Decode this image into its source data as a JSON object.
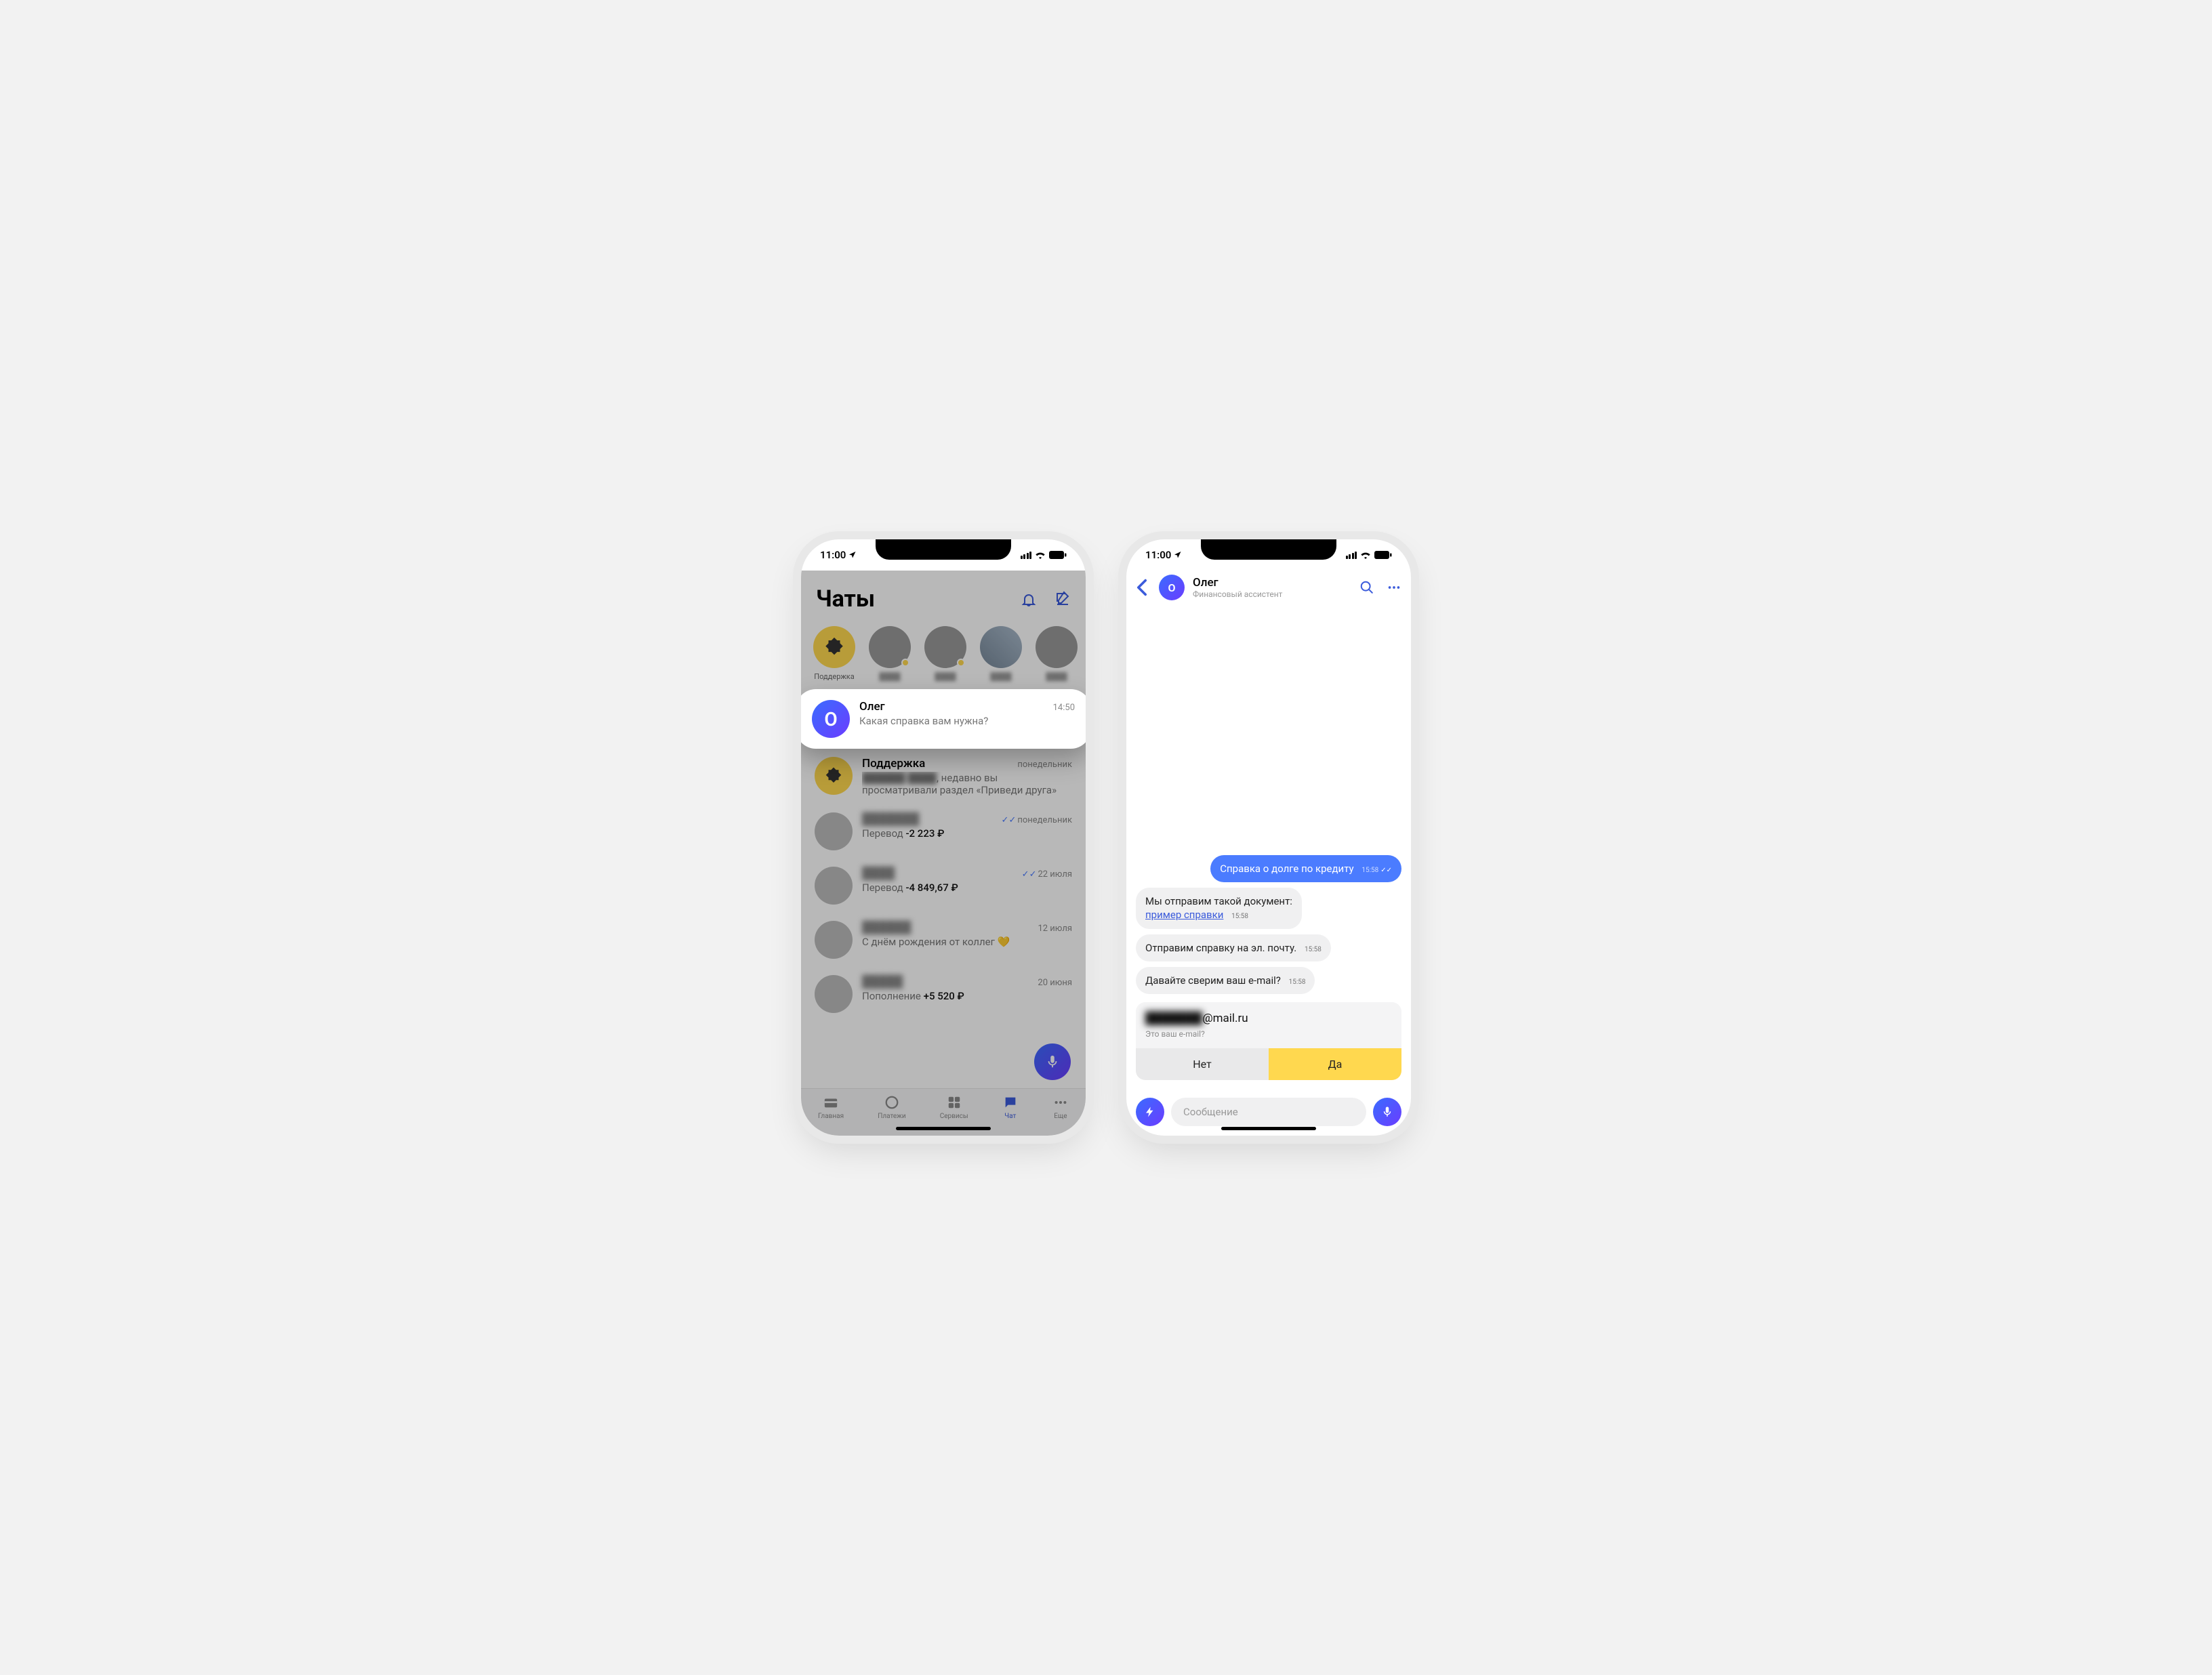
{
  "status": {
    "time": "11:00"
  },
  "left": {
    "title": "Чаты",
    "story_support": "Поддержка",
    "highlight": {
      "name": "Олег",
      "avatarLetter": "О",
      "preview": "Какая справка вам нужна?",
      "time": "14:50"
    },
    "chats": {
      "support": {
        "name": "Поддержка",
        "preview": ", недавно вы просматривали раздел «Приведи друга»",
        "time": "понедельник"
      },
      "c1": {
        "prefix": "Перевод",
        "amount": "-2 223 ₽",
        "time": "понедельник"
      },
      "c2": {
        "prefix": "Перевод",
        "amount": "-4 849,67 ₽",
        "time": "22 июля"
      },
      "c3": {
        "preview": "С днём рождения от коллег 💛",
        "time": "12 июля"
      },
      "c4": {
        "prefix": "Пополнение",
        "amount": "+5 520 ₽",
        "time": "20 июня"
      }
    },
    "tabs": {
      "home": "Главная",
      "payments": "Платежи",
      "services": "Сервисы",
      "chat": "Чат",
      "more": "Еще"
    }
  },
  "right": {
    "header": {
      "name": "Олег",
      "avatarLetter": "О",
      "subtitle": "Финансовый ассистент"
    },
    "messages": {
      "out1": {
        "text": "Справка о долге по кредиту",
        "time": "15:58"
      },
      "in1_pre": "Мы отправим такой документ:",
      "in1_link": "пример справки",
      "in1_time": "15:58",
      "in2": {
        "text": "Отправим справку на эл. почту.",
        "time": "15:58"
      },
      "in3": {
        "text": "Давайте сверим ваш e-mail?",
        "time": "15:58"
      }
    },
    "emailCard": {
      "domain": "@mail.ru",
      "sub": "Это ваш e-mail?",
      "no": "Нет",
      "yes": "Да"
    },
    "input": {
      "placeholder": "Сообщение"
    }
  }
}
